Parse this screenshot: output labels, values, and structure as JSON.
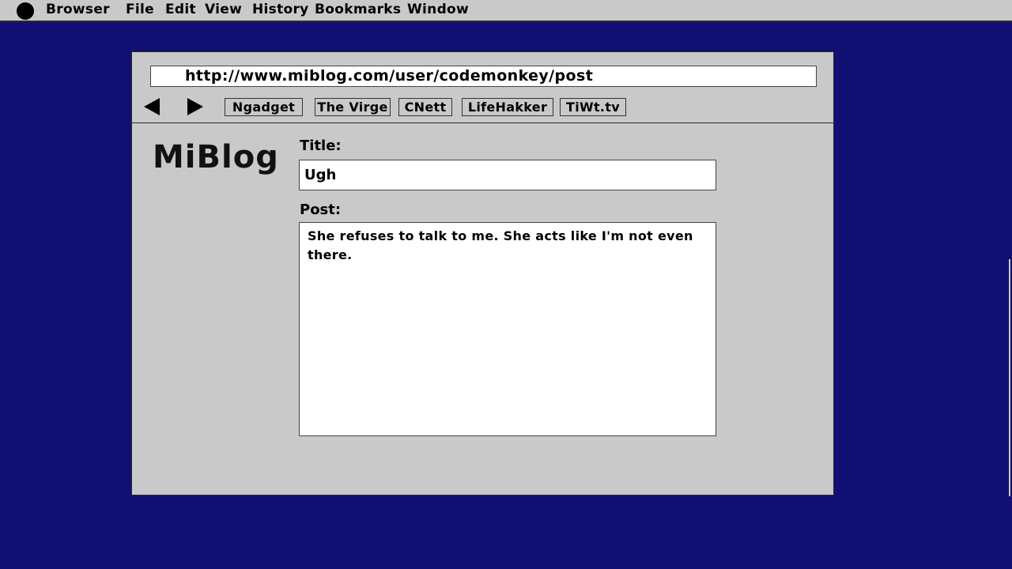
{
  "menubar": {
    "apple_icon": "apple-icon",
    "items": [
      "Browser",
      "File",
      "Edit",
      "View",
      "History",
      "Bookmarks",
      "Window"
    ]
  },
  "browser": {
    "url": "http://www.miblog.com/user/codemonkey/post",
    "nav": {
      "back_icon": "back-arrow-icon",
      "forward_icon": "forward-arrow-icon"
    },
    "bookmarks": [
      "Ngadget",
      "The Virge",
      "CNett",
      "LifeHakker",
      "TiWt.tv"
    ]
  },
  "page": {
    "logo": "MiBlog",
    "title_label": "Title:",
    "title_value": "Ugh",
    "post_label": "Post:",
    "post_value": "She refuses to talk to me. She acts like I'm not even there."
  },
  "colors": {
    "desktop": "#120f74",
    "chrome": "#c9c9c9",
    "field": "#ffffff"
  }
}
